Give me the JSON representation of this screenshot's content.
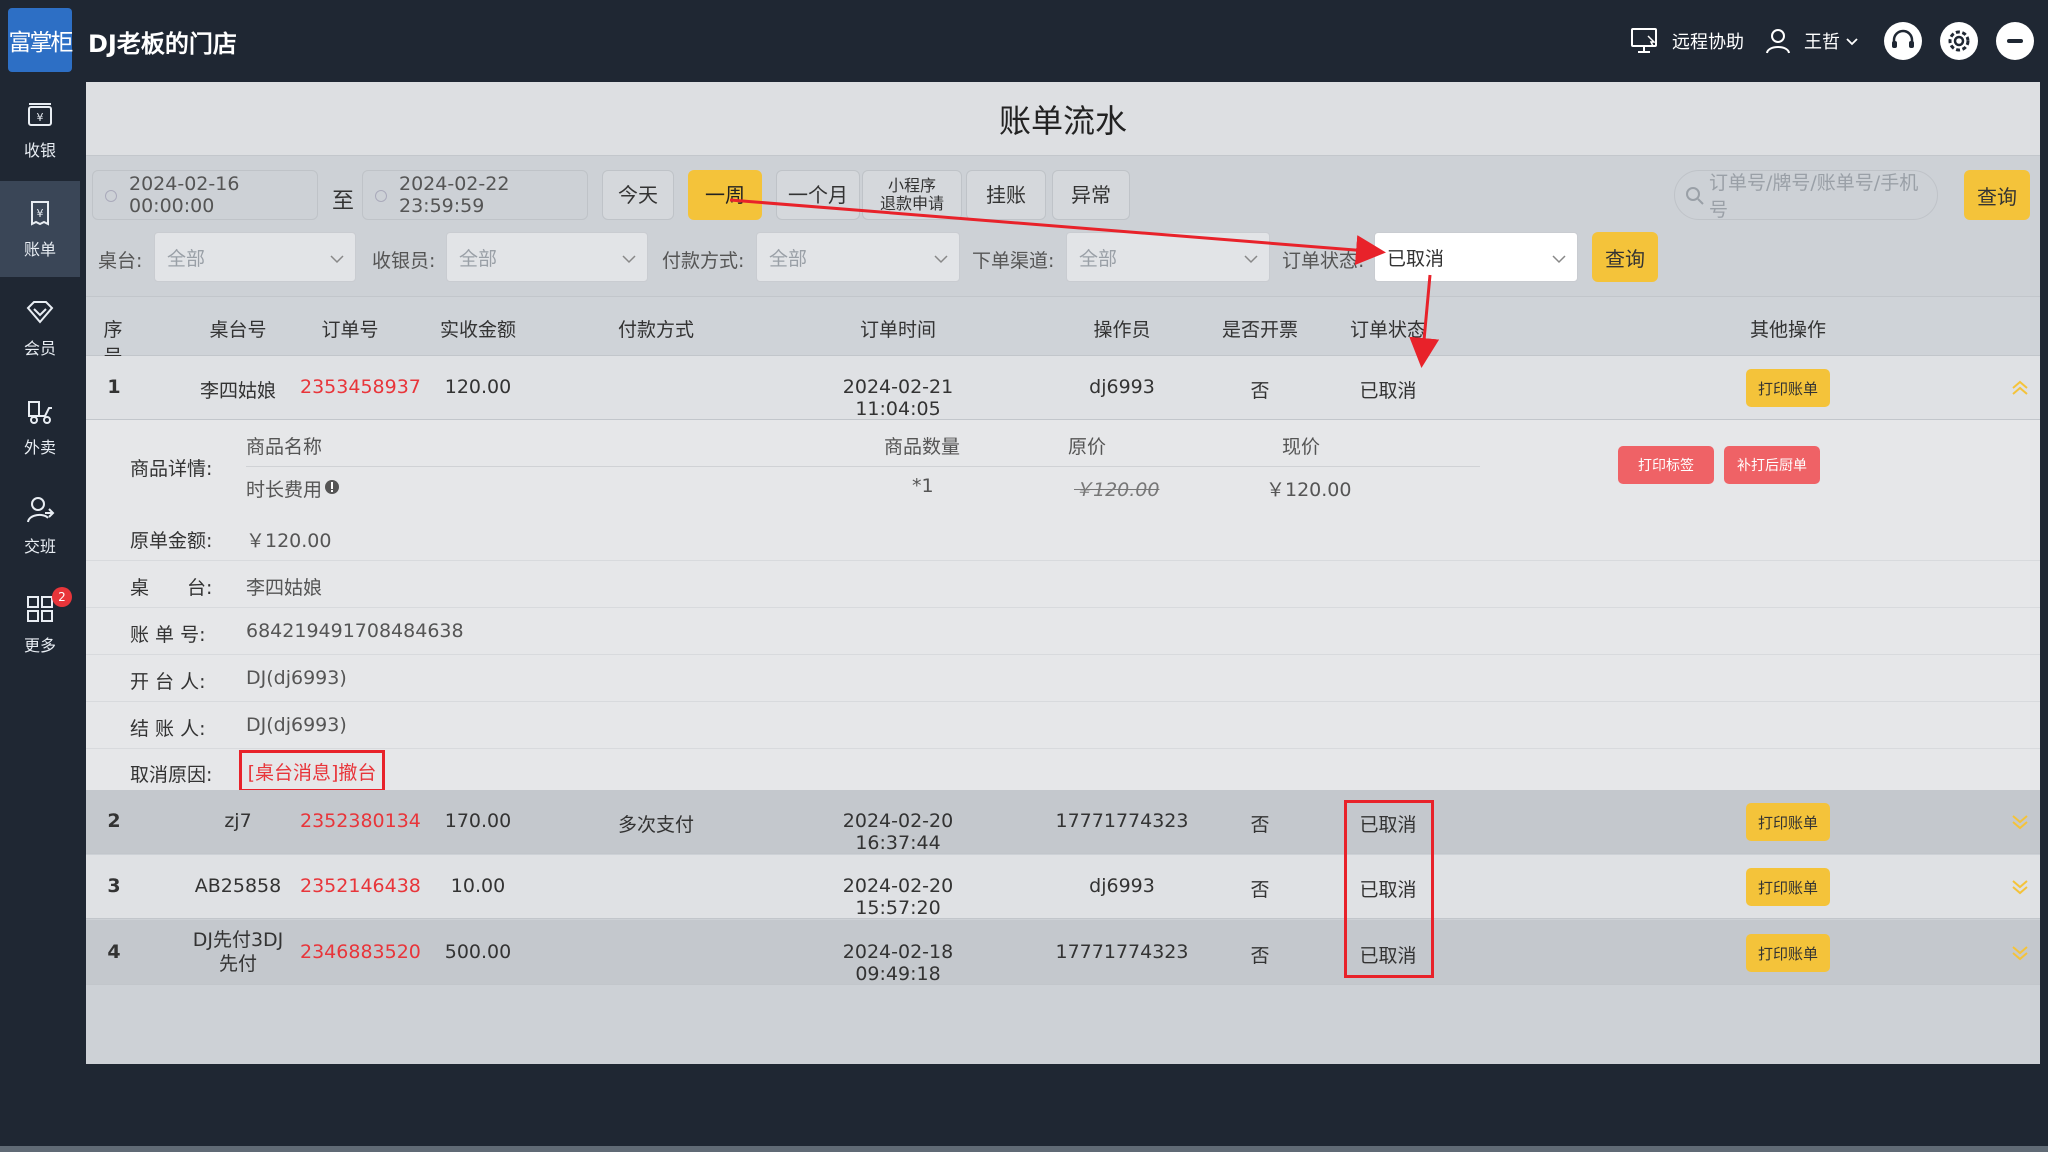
{
  "app": {
    "logo_text": "富掌柜",
    "store_name": "DJ老板的门店",
    "remote_assist": "远程协助",
    "user_name": "王哲"
  },
  "sidebar": {
    "items": [
      {
        "label": "收银",
        "icon": "cash-register-icon"
      },
      {
        "label": "账单",
        "icon": "bill-icon",
        "active": true
      },
      {
        "label": "会员",
        "icon": "member-diamond-icon"
      },
      {
        "label": "外卖",
        "icon": "delivery-icon"
      },
      {
        "label": "交班",
        "icon": "shift-handover-icon"
      },
      {
        "label": "更多",
        "icon": "more-grid-icon",
        "badge": "2"
      }
    ]
  },
  "page": {
    "title": "账单流水"
  },
  "filters": {
    "date_from": "2024-02-16 00:00:00",
    "date_sep": "至",
    "date_to": "2024-02-22 23:59:59",
    "quick_buttons": [
      "今天",
      "一周",
      "一个月",
      "小程序退款申请",
      "挂账",
      "异常"
    ],
    "mini_refund_line1": "小程序",
    "mini_refund_line2": "退款申请",
    "active_quick": "一周",
    "search_placeholder": "订单号/牌号/账单号/手机号",
    "search_button": "查询",
    "table_label": "桌台:",
    "table_value": "全部",
    "cashier_label": "收银员:",
    "cashier_value": "全部",
    "payment_label": "付款方式:",
    "payment_value": "全部",
    "channel_label": "下单渠道:",
    "channel_value": "全部",
    "status_label": "订单状态:",
    "status_value": "已取消",
    "query_button": "查询"
  },
  "table": {
    "headers": [
      "序号",
      "桌台号",
      "订单号",
      "实收金额",
      "付款方式",
      "订单时间",
      "操作员",
      "是否开票",
      "订单状态",
      "其他操作"
    ],
    "print_label": "打印账单",
    "rows": [
      {
        "index": "1",
        "table": "李四姑娘",
        "order_no": "2353458937",
        "amount": "120.00",
        "payment": "",
        "time": "2024-02-21 11:04:05",
        "operator": "dj6993",
        "invoice": "否",
        "status": "已取消"
      },
      {
        "index": "2",
        "table": "zj7",
        "order_no": "2352380134",
        "amount": "170.00",
        "payment": "多次支付",
        "time": "2024-02-20 16:37:44",
        "operator": "17771774323",
        "invoice": "否",
        "status": "已取消"
      },
      {
        "index": "3",
        "table": "AB25858",
        "order_no": "2352146438",
        "amount": "10.00",
        "payment": "",
        "time": "2024-02-20 15:57:20",
        "operator": "dj6993",
        "invoice": "否",
        "status": "已取消"
      },
      {
        "index": "4",
        "table_line1": "DJ先付3DJ",
        "table_line2": "先付",
        "order_no": "2346883520",
        "amount": "500.00",
        "payment": "",
        "time": "2024-02-18 09:49:18",
        "operator": "17771774323",
        "invoice": "否",
        "status": "已取消"
      }
    ]
  },
  "detail": {
    "goods_label": "商品详情:",
    "col_name": "商品名称",
    "col_qty": "商品数量",
    "col_orig": "原价",
    "col_now": "现价",
    "item_name": "时长费用",
    "item_qty": "*1",
    "item_orig": "￥120.00",
    "item_now": "￥120.00",
    "print_label_btn": "打印标签",
    "reprint_btn": "补打后厨单",
    "orig_amount_label": "原单金额:",
    "orig_amount": "￥120.00",
    "table_label": "桌　　台:",
    "table_value": "李四姑娘",
    "bill_no_label": "账 单 号:",
    "bill_no": "684219491708484638",
    "opener_label": "开 台 人:",
    "opener": "DJ(dj6993)",
    "checkout_label": "结 账 人:",
    "checkout": "DJ(dj6993)",
    "cancel_reason_label": "取消原因:",
    "cancel_reason": "[桌台消息]撤台"
  },
  "colors": {
    "accent_yellow": "#f4c33a",
    "danger_red": "#e8353a",
    "sidebar_bg": "#1f2733"
  }
}
